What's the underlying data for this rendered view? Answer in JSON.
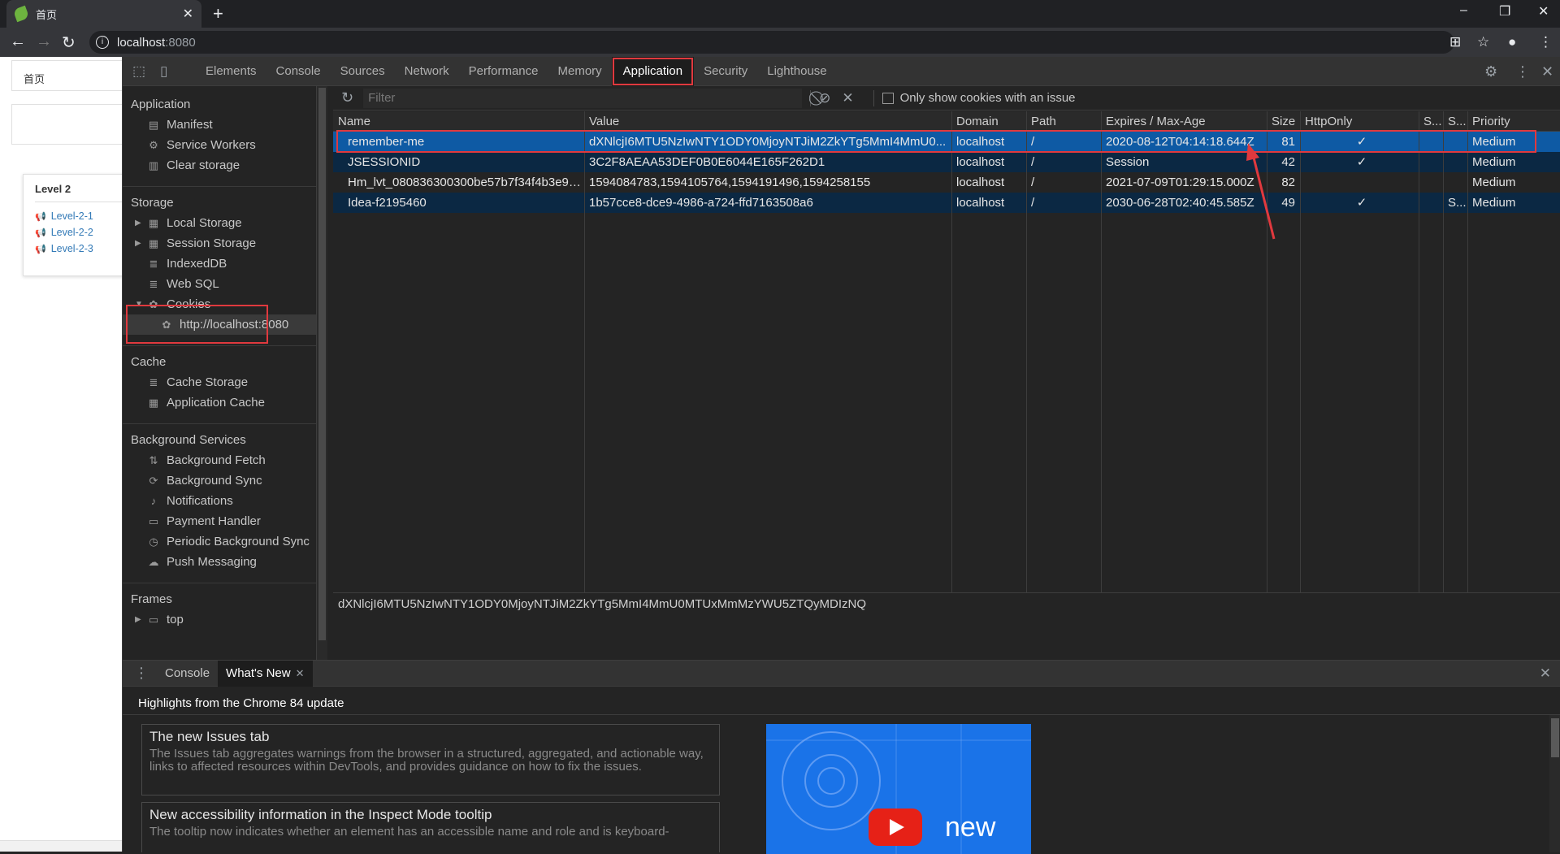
{
  "browser": {
    "tab_title": "首页",
    "url_host": "localhost",
    "url_port": ":8080"
  },
  "page": {
    "breadcrumb": "首页",
    "card_title": "Level 2",
    "links": [
      "Level-2-1",
      "Level-2-2",
      "Level-2-3"
    ]
  },
  "devtools": {
    "tabs": [
      "Elements",
      "Console",
      "Sources",
      "Network",
      "Performance",
      "Memory",
      "Application",
      "Security",
      "Lighthouse"
    ],
    "active_tab": "Application"
  },
  "sidebar": {
    "application_header": "Application",
    "application_items": [
      "Manifest",
      "Service Workers",
      "Clear storage"
    ],
    "storage_header": "Storage",
    "storage_items": [
      "Local Storage",
      "Session Storage",
      "IndexedDB",
      "Web SQL",
      "Cookies"
    ],
    "cookie_origin": "http://localhost:8080",
    "cache_header": "Cache",
    "cache_items": [
      "Cache Storage",
      "Application Cache"
    ],
    "bg_header": "Background Services",
    "bg_items": [
      "Background Fetch",
      "Background Sync",
      "Notifications",
      "Payment Handler",
      "Periodic Background Sync",
      "Push Messaging"
    ],
    "frames_header": "Frames",
    "frames_items": [
      "top"
    ]
  },
  "toolbar": {
    "filter_placeholder": "Filter",
    "issue_checkbox_label": "Only show cookies with an issue"
  },
  "cookies": {
    "columns": [
      "Name",
      "Value",
      "Domain",
      "Path",
      "Expires / Max-Age",
      "Size",
      "HttpOnly",
      "S...",
      "S...",
      "Priority"
    ],
    "rows": [
      [
        "remember-me",
        "dXNlcjI6MTU5NzIwNTY1ODY0MjoyNTJiM2ZkYTg5MmI4MmU0...",
        "localhost",
        "/",
        "2020-08-12T04:14:18.644Z",
        "81",
        "✓",
        "",
        "",
        "Medium"
      ],
      [
        "JSESSIONID",
        "3C2F8AEAA53DEF0B0E6044E165F262D1",
        "localhost",
        "/",
        "Session",
        "42",
        "✓",
        "",
        "",
        "Medium"
      ],
      [
        "Hm_lvt_080836300300be57b7f34f4b3e97...",
        "1594084783,1594105764,1594191496,1594258155",
        "localhost",
        "/",
        "2021-07-09T01:29:15.000Z",
        "82",
        "",
        "",
        "",
        "Medium"
      ],
      [
        "Idea-f2195460",
        "1b57cce8-dce9-4986-a724-ffd7163508a6",
        "localhost",
        "/",
        "2030-06-28T02:40:45.585Z",
        "49",
        "✓",
        "",
        "S...",
        "Medium"
      ]
    ],
    "selected_value": "dXNlcjI6MTU5NzIwNTY1ODY0MjoyNTJiM2ZkYTg5MmI4MmU0MTUxMmMzYWU5ZTQyMDIzNQ"
  },
  "drawer": {
    "tabs": [
      "Console",
      "What's New"
    ],
    "active_tab": "What's New",
    "highlight": "Highlights from the Chrome 84 update",
    "items": [
      {
        "title": "The new Issues tab",
        "desc": "The Issues tab aggregates warnings from the browser in a structured, aggregated, and actionable way, links to affected resources within DevTools, and provides guidance on how to fix the issues."
      },
      {
        "title": "New accessibility information in the Inspect Mode tooltip",
        "desc": "The tooltip now indicates whether an element has an accessible name and role and is keyboard-"
      }
    ],
    "promo_text": "new"
  }
}
